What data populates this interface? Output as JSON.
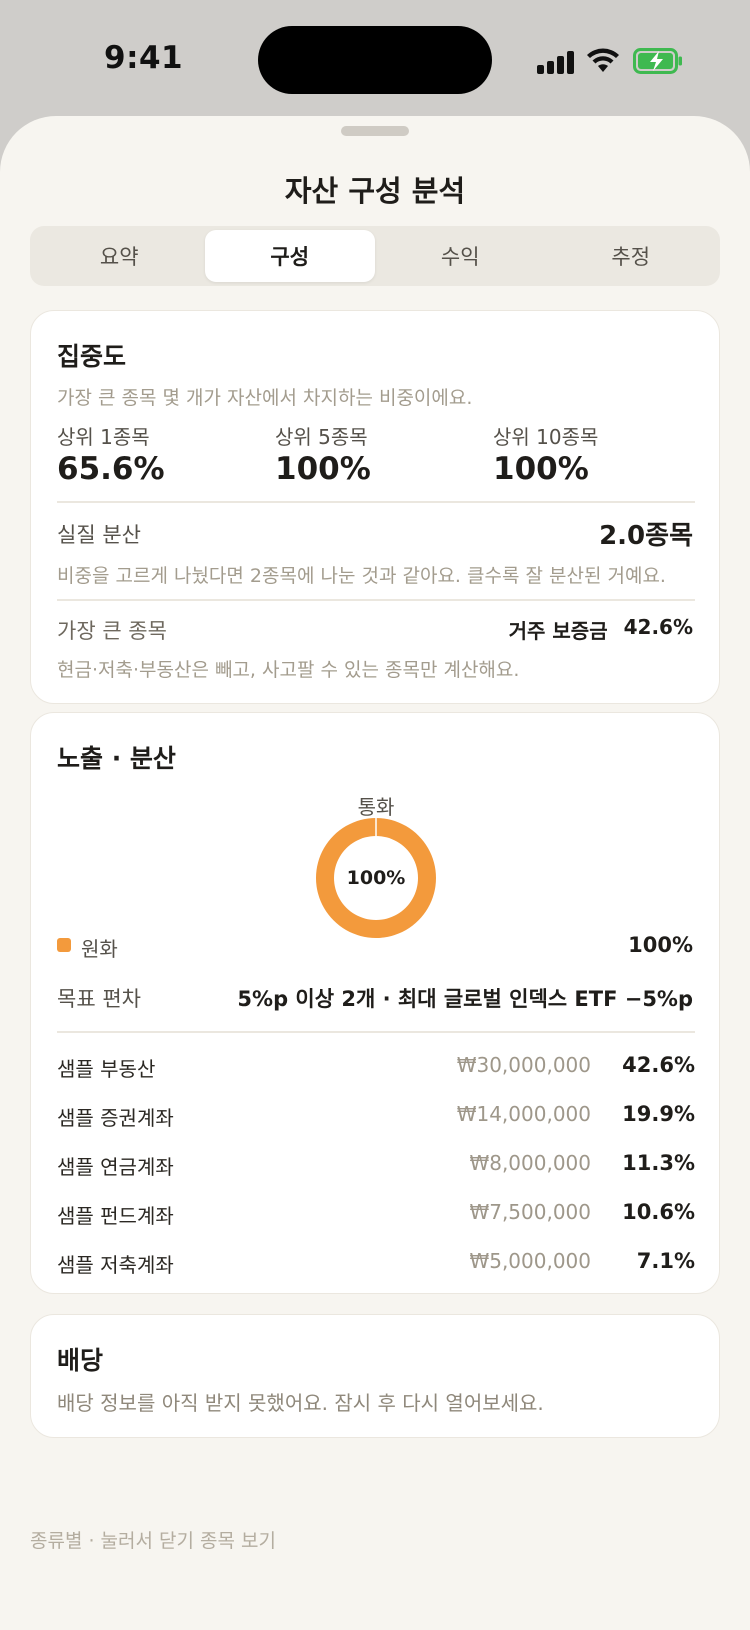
{
  "status": {
    "time": "9:41"
  },
  "sheet": {
    "title": "자산 구성 분석"
  },
  "tabs": [
    {
      "label": "요약",
      "active": false
    },
    {
      "label": "구성",
      "active": true
    },
    {
      "label": "수익",
      "active": false
    },
    {
      "label": "추정",
      "active": false
    }
  ],
  "concentration": {
    "title": "집중도",
    "description": "가장 큰 종목 몇 개가 자산에서 차지하는 비중이에요.",
    "stats": [
      {
        "label": "상위 1종목",
        "value": "65.6%"
      },
      {
        "label": "상위 5종목",
        "value": "100%"
      },
      {
        "label": "상위 10종목",
        "value": "100%"
      }
    ],
    "effective": {
      "label": "실질 분산",
      "value": "2.0종목",
      "note": "비중을 고르게 나눴다면 2종목에 나눈 것과 같아요. 클수록 잘 분산된 거예요."
    },
    "largest": {
      "label": "가장 큰 종목",
      "name": "거주 보증금",
      "pct": "42.6%",
      "note": "현금·저축·부동산은 빼고, 사고팔 수 있는 종목만 계산해요."
    }
  },
  "exposure": {
    "title": "노출 · 분산",
    "donut_label": "통화",
    "donut_center": "100%",
    "legend": [
      {
        "label": "원화",
        "value": "100%",
        "color": "#f39a3c"
      }
    ],
    "target_deviation": {
      "label": "목표 편차",
      "value": "5%p 이상 2개 · 최대 글로벌 인덱스 ETF −5%p"
    },
    "assets": [
      {
        "name": "샘플 부동산",
        "amount": "₩30,000,000",
        "pct": "42.6%"
      },
      {
        "name": "샘플 증권계좌",
        "amount": "₩14,000,000",
        "pct": "19.9%"
      },
      {
        "name": "샘플 연금계좌",
        "amount": "₩8,000,000",
        "pct": "11.3%"
      },
      {
        "name": "샘플 펀드계좌",
        "amount": "₩7,500,000",
        "pct": "10.6%"
      },
      {
        "name": "샘플 저축계좌",
        "amount": "₩5,000,000",
        "pct": "7.1%"
      }
    ]
  },
  "dividend": {
    "title": "배당",
    "message": "배당 정보를 아직 받지 못했어요. 잠시 후 다시 열어보세요."
  },
  "footer": {
    "hint": "종류별 · 눌러서 닫기 종목 보기"
  },
  "chart_data": {
    "type": "pie",
    "title": "통화",
    "categories": [
      "원화"
    ],
    "values": [
      100
    ],
    "colors": [
      "#f39a3c"
    ]
  }
}
